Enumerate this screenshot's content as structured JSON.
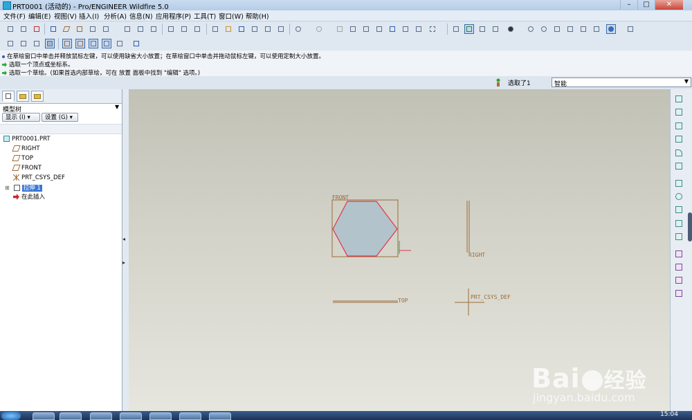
{
  "window": {
    "title": "PRT0001 (活动的) - Pro/ENGINEER Wildfire 5.0",
    "controls": {
      "minimize": "–",
      "maximize": "□",
      "close": "✕"
    }
  },
  "menu": [
    "文件(F)",
    "编辑(E)",
    "视图(V)",
    "插入(I)",
    "分析(A)",
    "信息(N)",
    "应用程序(P)",
    "工具(T)",
    "窗口(W)",
    "帮助(H)"
  ],
  "messages": [
    "在草绘窗口中单击并释放鼠标左键，可以使用缺省大小放置；在草绘窗口中单击并拖动鼠标左键，可以使用定制大小放置。",
    "选取一个顶点或坐标系。",
    "选取一个草绘。(如果首选内部草绘，可在 放置 面板中找到 \"编辑\" 选项。)"
  ],
  "status": {
    "selected": "选取了1",
    "filter_value": "智能"
  },
  "navigator": {
    "title": "模型树",
    "show_button": "显示 (I) ▾",
    "settings_button": "设置 (G) ▾",
    "tree": [
      {
        "label": "PRT0001.PRT",
        "icon": "part-icon"
      },
      {
        "label": "RIGHT",
        "icon": "datum-plane-icon"
      },
      {
        "label": "TOP",
        "icon": "datum-plane-icon"
      },
      {
        "label": "FRONT",
        "icon": "datum-plane-icon"
      },
      {
        "label": "PRT_CSYS_DEF",
        "icon": "csys-icon"
      },
      {
        "label": "拉伸 1",
        "icon": "extrude-icon",
        "selected": true
      },
      {
        "label": "在此插入",
        "icon": "insert-here-arrow-icon"
      }
    ]
  },
  "graphics": {
    "datum_labels": {
      "front": "FRONT",
      "right": "RIGHT",
      "top": "TOP",
      "csys": "PRT_CSYS_DEF"
    },
    "colors": {
      "datum": "#9a6a3a",
      "hexagon_fill": "#b3c3cc",
      "hexagon_edge": "#e0344a"
    }
  },
  "taskbar": {
    "time": "15:04"
  },
  "watermark": {
    "logo": "Bai",
    "logo_cn": "经验",
    "url": "jingyan.baidu.com"
  }
}
